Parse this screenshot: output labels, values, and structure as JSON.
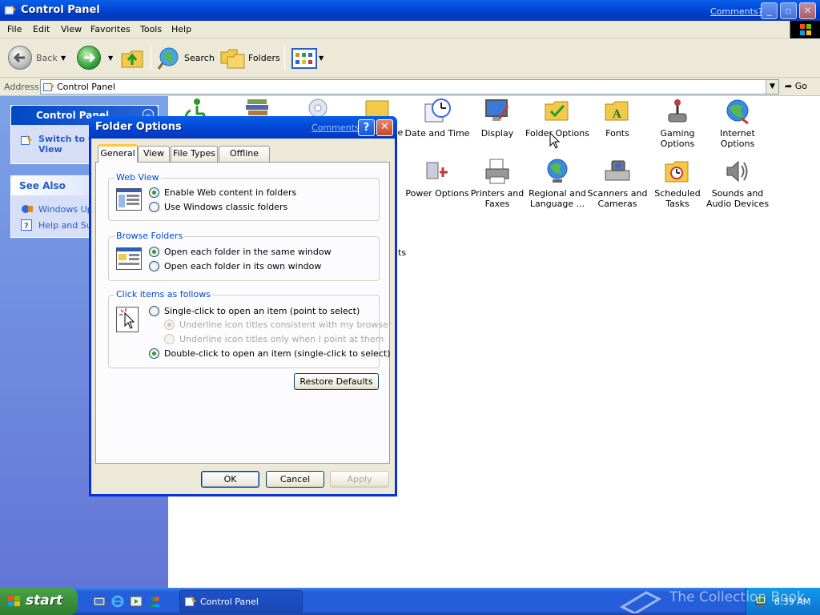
{
  "window": {
    "title": "Control Panel",
    "comments_link": "Comments?"
  },
  "menu": [
    "File",
    "Edit",
    "View",
    "Favorites",
    "Tools",
    "Help"
  ],
  "toolbar": {
    "back_label": "Back",
    "search_label": "Search",
    "folders_label": "Folders"
  },
  "address": {
    "label": "Address",
    "value": "Control Panel",
    "go_label": "Go"
  },
  "taskpane": {
    "control_panel_title": "Control Panel",
    "switch_view_line1": "Switch to C",
    "switch_view_line2": "View",
    "see_also_title": "See Also",
    "windows_update": "Windows Upd",
    "help_support": "Help and Sup"
  },
  "content": {
    "partial_text_1": "ve",
    "partial_text_2": "l",
    "partial_text_3": "ts",
    "row1": [
      {
        "line1": "Date and Time",
        "line2": "",
        "icon": "date-time-icon"
      },
      {
        "line1": "Display",
        "line2": "",
        "icon": "display-icon"
      },
      {
        "line1": "Folder Options",
        "line2": "",
        "icon": "folder-options-icon"
      },
      {
        "line1": "Fonts",
        "line2": "",
        "icon": "fonts-icon"
      },
      {
        "line1": "Gaming",
        "line2": "Options",
        "icon": "gaming-options-icon"
      },
      {
        "line1": "Internet",
        "line2": "Options",
        "icon": "internet-options-icon"
      }
    ],
    "row2": [
      {
        "line1": "Power Options",
        "line2": "",
        "icon": "power-options-icon"
      },
      {
        "line1": "Printers and",
        "line2": "Faxes",
        "icon": "printers-icon"
      },
      {
        "line1": "Regional and",
        "line2": "Language ...",
        "icon": "regional-icon"
      },
      {
        "line1": "Scanners and",
        "line2": "Cameras",
        "icon": "scanners-icon"
      },
      {
        "line1": "Scheduled",
        "line2": "Tasks",
        "icon": "scheduled-tasks-icon"
      },
      {
        "line1": "Sounds and",
        "line2": "Audio Devices",
        "icon": "sounds-icon"
      }
    ]
  },
  "dialog": {
    "title": "Folder Options",
    "comments_link": "Comments?",
    "help_glyph": "?",
    "close_glyph": "✕",
    "tabs": [
      "General",
      "View",
      "File Types",
      "Offline Files"
    ],
    "web_view": {
      "label": "Web View",
      "option1": "Enable Web content in folders",
      "option2": "Use Windows classic folders"
    },
    "browse_folders": {
      "label": "Browse Folders",
      "option1": "Open each folder in the same window",
      "option2": "Open each folder in its own window"
    },
    "click_items": {
      "label": "Click items as follows",
      "option1": "Single-click to open an item (point to select)",
      "sub1": "Underline icon titles consistent with my browser",
      "sub2": "Underline icon titles only when I point at them",
      "option2": "Double-click to open an item (single-click to select)"
    },
    "restore_defaults": "Restore Defaults",
    "ok": "OK",
    "cancel": "Cancel",
    "apply": "Apply"
  },
  "taskbar": {
    "start": "start",
    "task_window": "Control Panel",
    "clock": "8:39 AM",
    "watermark": "The Collection Book"
  }
}
